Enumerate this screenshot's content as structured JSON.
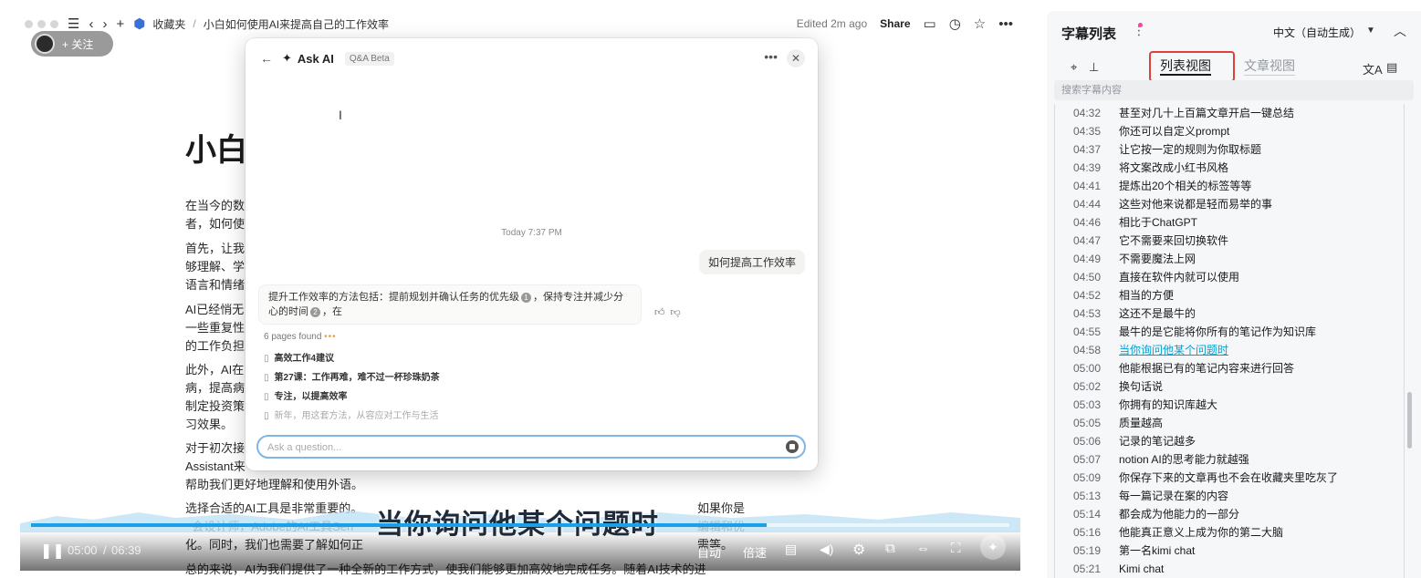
{
  "topbar": {
    "breadcrumb_root": "收藏夹",
    "breadcrumb_sep": "/",
    "page_title": "小白如何使用AI来提高自己的工作效率",
    "edited": "Edited 2m ago",
    "share": "Share"
  },
  "follow": {
    "label": "+ 关注"
  },
  "doc": {
    "title": "小白",
    "p1": "在当今的数\n者，如何使",
    "p2": "首先，让我\n够理解、学\n语言和情绪",
    "p3": "AI已经悄无\n一些重复性\n的工作负担",
    "p4": "此外，AI在\n病，提高病\n制定投资策\n习效果。",
    "p5": "对于初次接\nAssistant来\n帮助我们更好地理解和使用外语。",
    "p6": "选择合适的AI工具是非常重要的。\n  会设计师，Adobe的AI工具Sen\n化。同时，我们也需要了解如何正",
    "p6_right": "如果你是\n编辑和优\n需等。",
    "bottom": "总的来说，AI为我们提供了一种全新的工作方式，使我们能够更加高效地完成任务。随着AI技术的进"
  },
  "video": {
    "subtitle": "当你询问他某个问题时",
    "current_time": "05:00",
    "time_sep": "/",
    "duration": "06:39",
    "progress": 0.752,
    "btn_auto": "自动",
    "btn_speed": "倍速"
  },
  "askai": {
    "title": "Ask AI",
    "badge": "Q&A Beta",
    "time": "Today 7:37 PM",
    "user_question": "如何提高工作效率",
    "answer_part1": "提升工作效率的方法包括：提前规划并确认任务的优先级",
    "ref1": "1",
    "answer_part2": "，保持专注并减少分心的时间",
    "ref2": "2",
    "answer_part3": "，在",
    "pages_found": "6 pages found",
    "sources": [
      "高效工作4建议",
      "第27课：工作再难，难不过一杯珍珠奶茶",
      "专注，以提高效率",
      "新年，用这套方法，从容应对工作与生活"
    ],
    "input_placeholder": "Ask a question..."
  },
  "side": {
    "title": "字幕列表",
    "language": "中文（自动生成）",
    "tab_list": "列表视图",
    "tab_article": "文章视图",
    "search_placeholder": "搜索字幕内容",
    "rows": [
      {
        "ts": "04:32",
        "text": "甚至对几十上百篇文章开启一键总结"
      },
      {
        "ts": "04:35",
        "text": "你还可以自定义prompt"
      },
      {
        "ts": "04:37",
        "text": "让它按一定的规则为你取标题"
      },
      {
        "ts": "04:39",
        "text": "将文案改成小红书风格"
      },
      {
        "ts": "04:41",
        "text": "提炼出20个相关的标签等等"
      },
      {
        "ts": "04:44",
        "text": "这些对他来说都是轻而易举的事"
      },
      {
        "ts": "04:46",
        "text": "相比于ChatGPT"
      },
      {
        "ts": "04:47",
        "text": "它不需要来回切换软件"
      },
      {
        "ts": "04:49",
        "text": "不需要魔法上网"
      },
      {
        "ts": "04:50",
        "text": "直接在软件内就可以使用"
      },
      {
        "ts": "04:52",
        "text": "相当的方便"
      },
      {
        "ts": "04:53",
        "text": "这还不是最牛的"
      },
      {
        "ts": "04:55",
        "text": "最牛的是它能将你所有的笔记作为知识库"
      },
      {
        "ts": "04:58",
        "text": "当你询问他某个问题时"
      },
      {
        "ts": "05:00",
        "text": "他能根据已有的笔记内容来进行回答"
      },
      {
        "ts": "05:02",
        "text": "换句话说"
      },
      {
        "ts": "05:03",
        "text": "你拥有的知识库越大"
      },
      {
        "ts": "05:05",
        "text": "质量越高"
      },
      {
        "ts": "05:06",
        "text": "记录的笔记越多"
      },
      {
        "ts": "05:07",
        "text": "notion AI的思考能力就越强"
      },
      {
        "ts": "05:09",
        "text": "你保存下来的文章再也不会在收藏夹里吃灰了"
      },
      {
        "ts": "05:13",
        "text": "每一篇记录在案的内容"
      },
      {
        "ts": "05:14",
        "text": "都会成为他能力的一部分"
      },
      {
        "ts": "05:16",
        "text": "他能真正意义上成为你的第二大脑"
      },
      {
        "ts": "05:19",
        "text": "第一名kimi chat"
      },
      {
        "ts": "05:21",
        "text": "Kimi chat"
      }
    ],
    "active_index": 13
  }
}
